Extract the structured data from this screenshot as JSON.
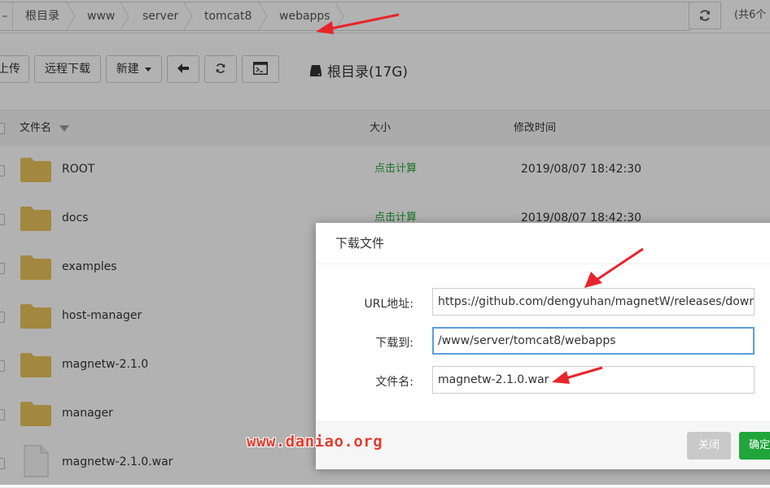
{
  "breadcrumb": {
    "items": [
      "根目录",
      "www",
      "server",
      "tomcat8",
      "webapps"
    ]
  },
  "header": {
    "count_text": "(共6个"
  },
  "toolbar": {
    "upload": "上传",
    "remote_download": "远程下载",
    "new": "新建",
    "disk_label": "根目录(17G)"
  },
  "table": {
    "columns": {
      "name": "文件名",
      "size": "大小",
      "modified": "修改时间"
    },
    "rows": [
      {
        "type": "folder",
        "name": "ROOT",
        "size": "点击计算",
        "modified": "2019/08/07 18:42:30"
      },
      {
        "type": "folder",
        "name": "docs",
        "size": "点击计算",
        "modified": "2019/08/07 18:42:30"
      },
      {
        "type": "folder",
        "name": "examples",
        "size": "",
        "modified": ""
      },
      {
        "type": "folder",
        "name": "host-manager",
        "size": "",
        "modified": ""
      },
      {
        "type": "folder",
        "name": "magnetw-2.1.0",
        "size": "",
        "modified": ""
      },
      {
        "type": "folder",
        "name": "manager",
        "size": "",
        "modified": ""
      },
      {
        "type": "file",
        "name": "magnetw-2.1.0.war",
        "size": "",
        "modified": ""
      }
    ]
  },
  "dialog": {
    "title": "下载文件",
    "url_label": "URL地址:",
    "url_value": "https://github.com/dengyuhan/magnetW/releases/down",
    "dest_label": "下载到:",
    "dest_value": "/www/server/tomcat8/webapps",
    "filename_label": "文件名:",
    "filename_value": "magnetw-2.1.0.war",
    "close_button": "关闭",
    "confirm_button": "确定"
  },
  "watermark": "www.daniao.org",
  "colors": {
    "accent_green": "#20a53a",
    "folder": "#e8c25a",
    "arrow_red": "#e8242a"
  }
}
